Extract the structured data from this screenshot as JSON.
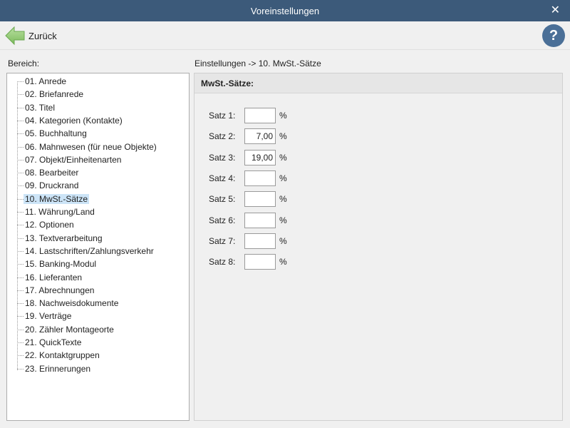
{
  "window": {
    "title": "Voreinstellungen",
    "close_glyph": "✕"
  },
  "toolbar": {
    "back_label": "Zurück",
    "help_glyph": "?"
  },
  "left": {
    "label": "Bereich:"
  },
  "breadcrumb": "Einstellungen -> 10. MwSt.-Sätze",
  "tree": {
    "items": [
      "01. Anrede",
      "02. Briefanrede",
      "03. Titel",
      "04. Kategorien (Kontakte)",
      "05. Buchhaltung",
      "06. Mahnwesen (für neue Objekte)",
      "07. Objekt/Einheitenarten",
      "08. Bearbeiter",
      "09. Druckrand",
      "10. MwSt.-Sätze",
      "11. Währung/Land",
      "12. Optionen",
      "13. Textverarbeitung",
      "14. Lastschriften/Zahlungsverkehr",
      "15. Banking-Modul",
      "16. Lieferanten",
      "17. Abrechnungen",
      "18. Nachweisdokumente",
      "19. Verträge",
      "20. Zähler Montageorte",
      "21. QuickTexte",
      "22. Kontaktgruppen",
      "23. Erinnerungen"
    ],
    "selected_index": 9
  },
  "panel": {
    "header": "MwSt.-Sätze:",
    "unit": "%",
    "rates": [
      {
        "label": "Satz 1:",
        "value": ""
      },
      {
        "label": "Satz 2:",
        "value": "7,00"
      },
      {
        "label": "Satz 3:",
        "value": "19,00"
      },
      {
        "label": "Satz 4:",
        "value": ""
      },
      {
        "label": "Satz 5:",
        "value": ""
      },
      {
        "label": "Satz 6:",
        "value": ""
      },
      {
        "label": "Satz 7:",
        "value": ""
      },
      {
        "label": "Satz 8:",
        "value": ""
      }
    ]
  },
  "icons": {
    "back": "green-left-arrow-icon",
    "help": "question-mark-icon",
    "close": "close-icon"
  },
  "colors": {
    "titlebar": "#3c5a7a",
    "selection": "#cce4f7",
    "help": "#4a6f97"
  }
}
